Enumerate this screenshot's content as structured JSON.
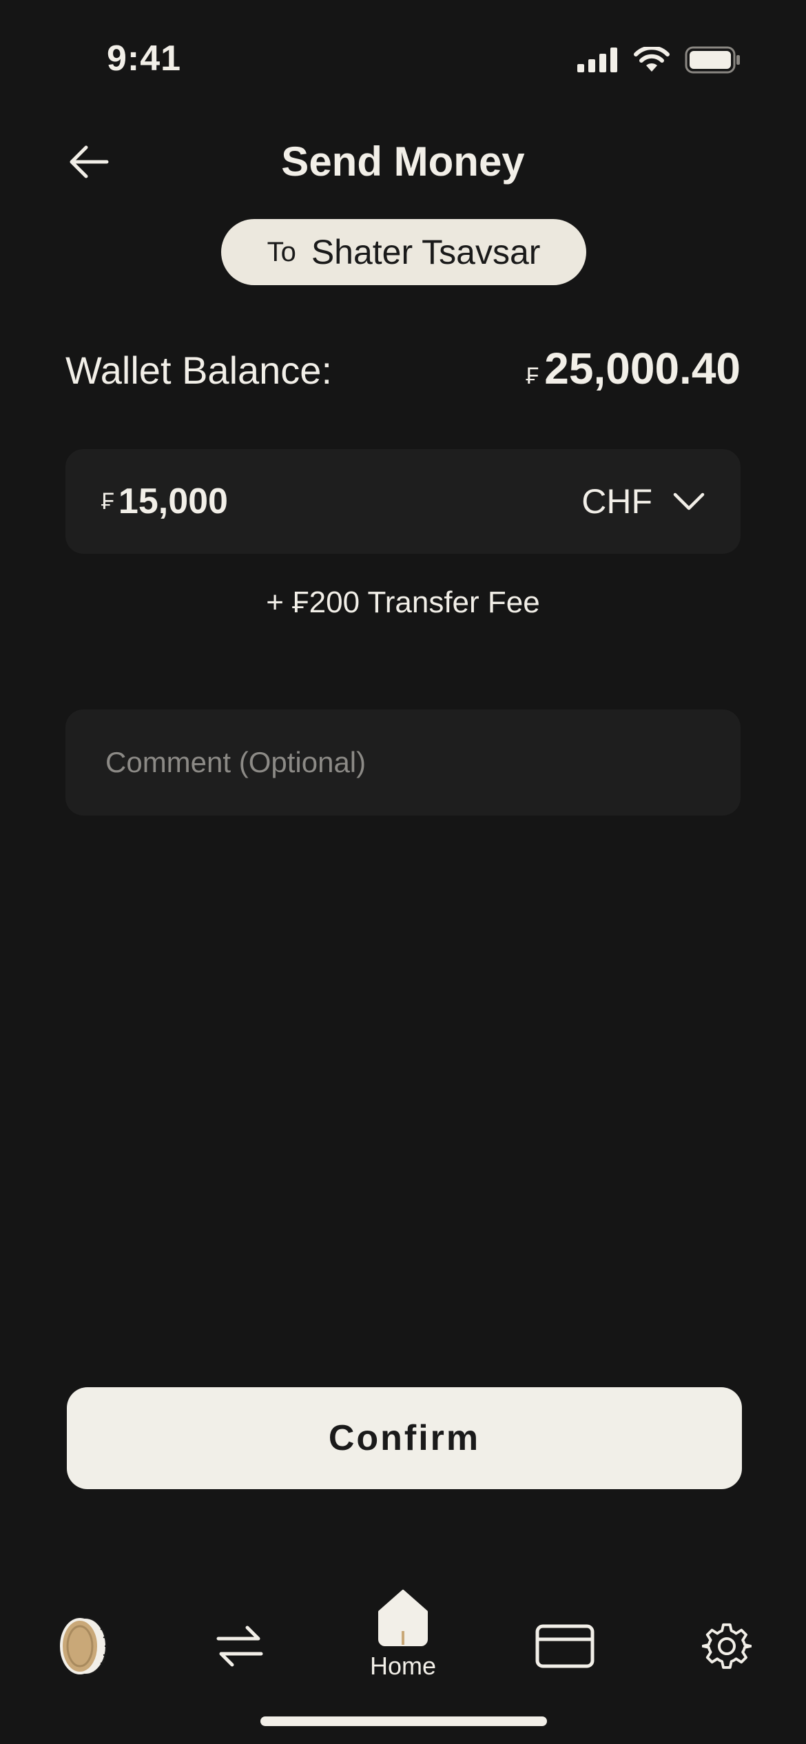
{
  "status_bar": {
    "time": "9:41"
  },
  "header": {
    "title": "Send Money"
  },
  "recipient": {
    "prefix": "To",
    "name": "Shater Tsavsar"
  },
  "wallet": {
    "label": "Wallet Balance:",
    "currency_symbol": "₣",
    "amount": "25,000.40"
  },
  "transfer": {
    "currency_symbol": "₣",
    "amount": "15,000",
    "currency_code": "CHF",
    "fee_text": "+ ₣200 Transfer Fee"
  },
  "comment": {
    "placeholder": "Comment (Optional)",
    "value": ""
  },
  "actions": {
    "confirm_label": "Confirm"
  },
  "bottom_nav": {
    "items": [
      {
        "icon": "coin-icon",
        "label": ""
      },
      {
        "icon": "transfer-arrows-icon",
        "label": ""
      },
      {
        "icon": "home-icon",
        "label": "Home"
      },
      {
        "icon": "card-icon",
        "label": ""
      },
      {
        "icon": "gear-icon",
        "label": ""
      }
    ],
    "active": "Home"
  },
  "colors": {
    "background": "#151515",
    "surface": "#1e1e1e",
    "text": "#f2efe8",
    "pill": "#ece8de",
    "accent_gold": "#c9a878"
  }
}
